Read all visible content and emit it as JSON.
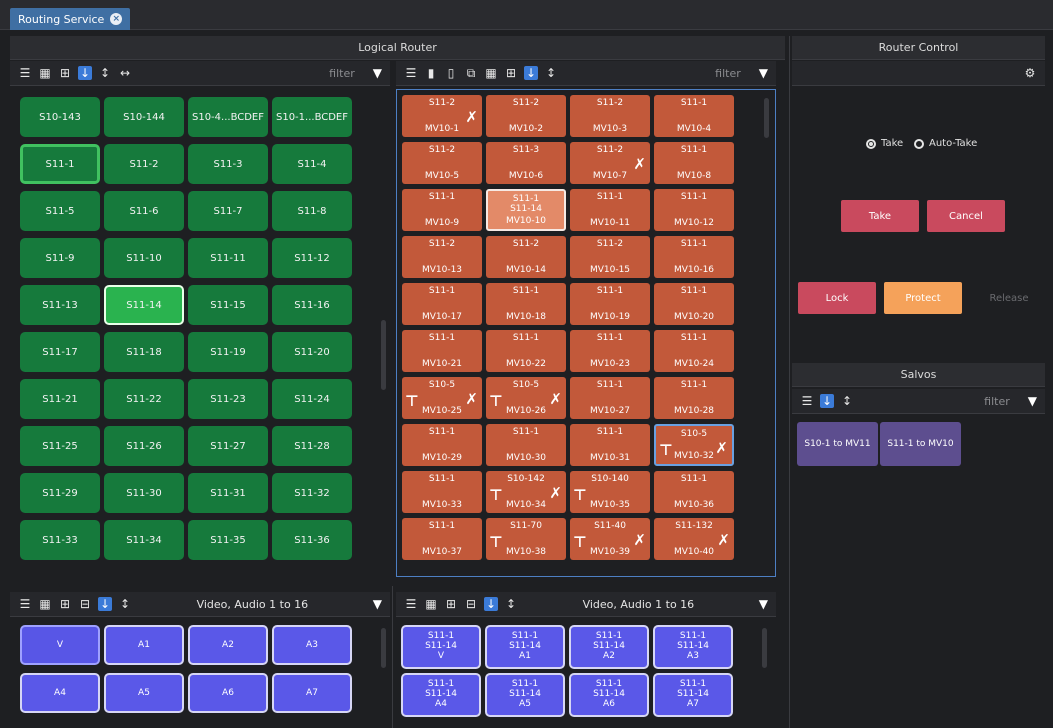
{
  "tab": {
    "title": "Routing Service"
  },
  "logical_router": {
    "title": "Logical Router",
    "src_filter_placeholder": "filter",
    "dst_filter_placeholder": "filter"
  },
  "sources": [
    "S10-143",
    "S10-144",
    "S10-4...BCDEF",
    "S10-1...BCDEF",
    "S11-1",
    "S11-2",
    "S11-3",
    "S11-4",
    "S11-5",
    "S11-6",
    "S11-7",
    "S11-8",
    "S11-9",
    "S11-10",
    "S11-11",
    "S11-12",
    "S11-13",
    "S11-14",
    "S11-15",
    "S11-16",
    "S11-17",
    "S11-18",
    "S11-19",
    "S11-20",
    "S11-21",
    "S11-22",
    "S11-23",
    "S11-24",
    "S11-25",
    "S11-26",
    "S11-27",
    "S11-28",
    "S11-29",
    "S11-30",
    "S11-31",
    "S11-32",
    "S11-33",
    "S11-34",
    "S11-35",
    "S11-36"
  ],
  "destinations": [
    {
      "src": "S11-2",
      "dst": "MV10-1",
      "mark": "swap"
    },
    {
      "src": "S11-2",
      "dst": "MV10-2"
    },
    {
      "src": "S11-2",
      "dst": "MV10-3"
    },
    {
      "src": "S11-1",
      "dst": "MV10-4"
    },
    {
      "src": "S11-2",
      "dst": "MV10-5"
    },
    {
      "src": "S11-3",
      "dst": "MV10-6"
    },
    {
      "src": "S11-2",
      "dst": "MV10-7",
      "mark": "swap"
    },
    {
      "src": "S11-1",
      "dst": "MV10-8"
    },
    {
      "src": "S11-1",
      "dst": "MV10-9"
    },
    {
      "src": "S11-1",
      "pending": "S11-14",
      "dst": "MV10-10",
      "sel": true
    },
    {
      "src": "S11-1",
      "dst": "MV10-11"
    },
    {
      "src": "S11-1",
      "dst": "MV10-12"
    },
    {
      "src": "S11-2",
      "dst": "MV10-13"
    },
    {
      "src": "S11-2",
      "dst": "MV10-14"
    },
    {
      "src": "S11-2",
      "dst": "MV10-15"
    },
    {
      "src": "S11-1",
      "dst": "MV10-16"
    },
    {
      "src": "S11-1",
      "dst": "MV10-17"
    },
    {
      "src": "S11-1",
      "dst": "MV10-18"
    },
    {
      "src": "S11-1",
      "dst": "MV10-19"
    },
    {
      "src": "S11-1",
      "dst": "MV10-20"
    },
    {
      "src": "S11-1",
      "dst": "MV10-21"
    },
    {
      "src": "S11-1",
      "dst": "MV10-22"
    },
    {
      "src": "S11-1",
      "dst": "MV10-23"
    },
    {
      "src": "S11-1",
      "dst": "MV10-24"
    },
    {
      "src": "S10-5",
      "dst": "MV10-25",
      "mark": "both"
    },
    {
      "src": "S10-5",
      "dst": "MV10-26",
      "mark": "both"
    },
    {
      "src": "S11-1",
      "dst": "MV10-27"
    },
    {
      "src": "S11-1",
      "dst": "MV10-28"
    },
    {
      "src": "S11-1",
      "dst": "MV10-29"
    },
    {
      "src": "S11-1",
      "dst": "MV10-30"
    },
    {
      "src": "S11-1",
      "dst": "MV10-31"
    },
    {
      "src": "S10-5",
      "dst": "MV10-32",
      "mark": "both",
      "hl": true
    },
    {
      "src": "S11-1",
      "dst": "MV10-33"
    },
    {
      "src": "S10-142",
      "dst": "MV10-34",
      "mark": "both"
    },
    {
      "src": "S10-140",
      "dst": "MV10-35",
      "mark": "lock"
    },
    {
      "src": "S11-1",
      "dst": "MV10-36"
    },
    {
      "src": "S11-1",
      "dst": "MV10-37"
    },
    {
      "src": "S11-70",
      "dst": "MV10-38",
      "mark": "lock"
    },
    {
      "src": "S11-40",
      "dst": "MV10-39",
      "mark": "both"
    },
    {
      "src": "S11-132",
      "dst": "MV10-40",
      "mark": "swap"
    }
  ],
  "src_levels": {
    "combo": "Video, Audio 1 to 16",
    "items": [
      "V",
      "A1",
      "A2",
      "A3",
      "A4",
      "A5",
      "A6",
      "A7"
    ]
  },
  "dst_levels": {
    "combo": "Video, Audio 1 to 16",
    "items": [
      {
        "l1": "S11-1",
        "l2": "S11-14",
        "l3": "V"
      },
      {
        "l1": "S11-1",
        "l2": "S11-14",
        "l3": "A1"
      },
      {
        "l1": "S11-1",
        "l2": "S11-14",
        "l3": "A2"
      },
      {
        "l1": "S11-1",
        "l2": "S11-14",
        "l3": "A3"
      },
      {
        "l1": "S11-1",
        "l2": "S11-14",
        "l3": "A4"
      },
      {
        "l1": "S11-1",
        "l2": "S11-14",
        "l3": "A5"
      },
      {
        "l1": "S11-1",
        "l2": "S11-14",
        "l3": "A6"
      },
      {
        "l1": "S11-1",
        "l2": "S11-14",
        "l3": "A7"
      }
    ]
  },
  "router_control": {
    "title": "Router Control",
    "take_radio": "Take",
    "auto_take_radio": "Auto-Take",
    "take_button": "Take",
    "cancel_button": "Cancel",
    "lock_button": "Lock",
    "protect_button": "Protect",
    "release_button": "Release"
  },
  "salvos": {
    "title": "Salvos",
    "filter_placeholder": "filter",
    "items": [
      "S10-1 to MV11",
      "S11-1 to MV10"
    ]
  },
  "colors": {
    "source": "#167a3c",
    "destination": "#c2593a",
    "level": "#5a58e8",
    "take": "#c94a5e",
    "protect": "#f5a25a",
    "salvo": "#5d4e8f"
  }
}
